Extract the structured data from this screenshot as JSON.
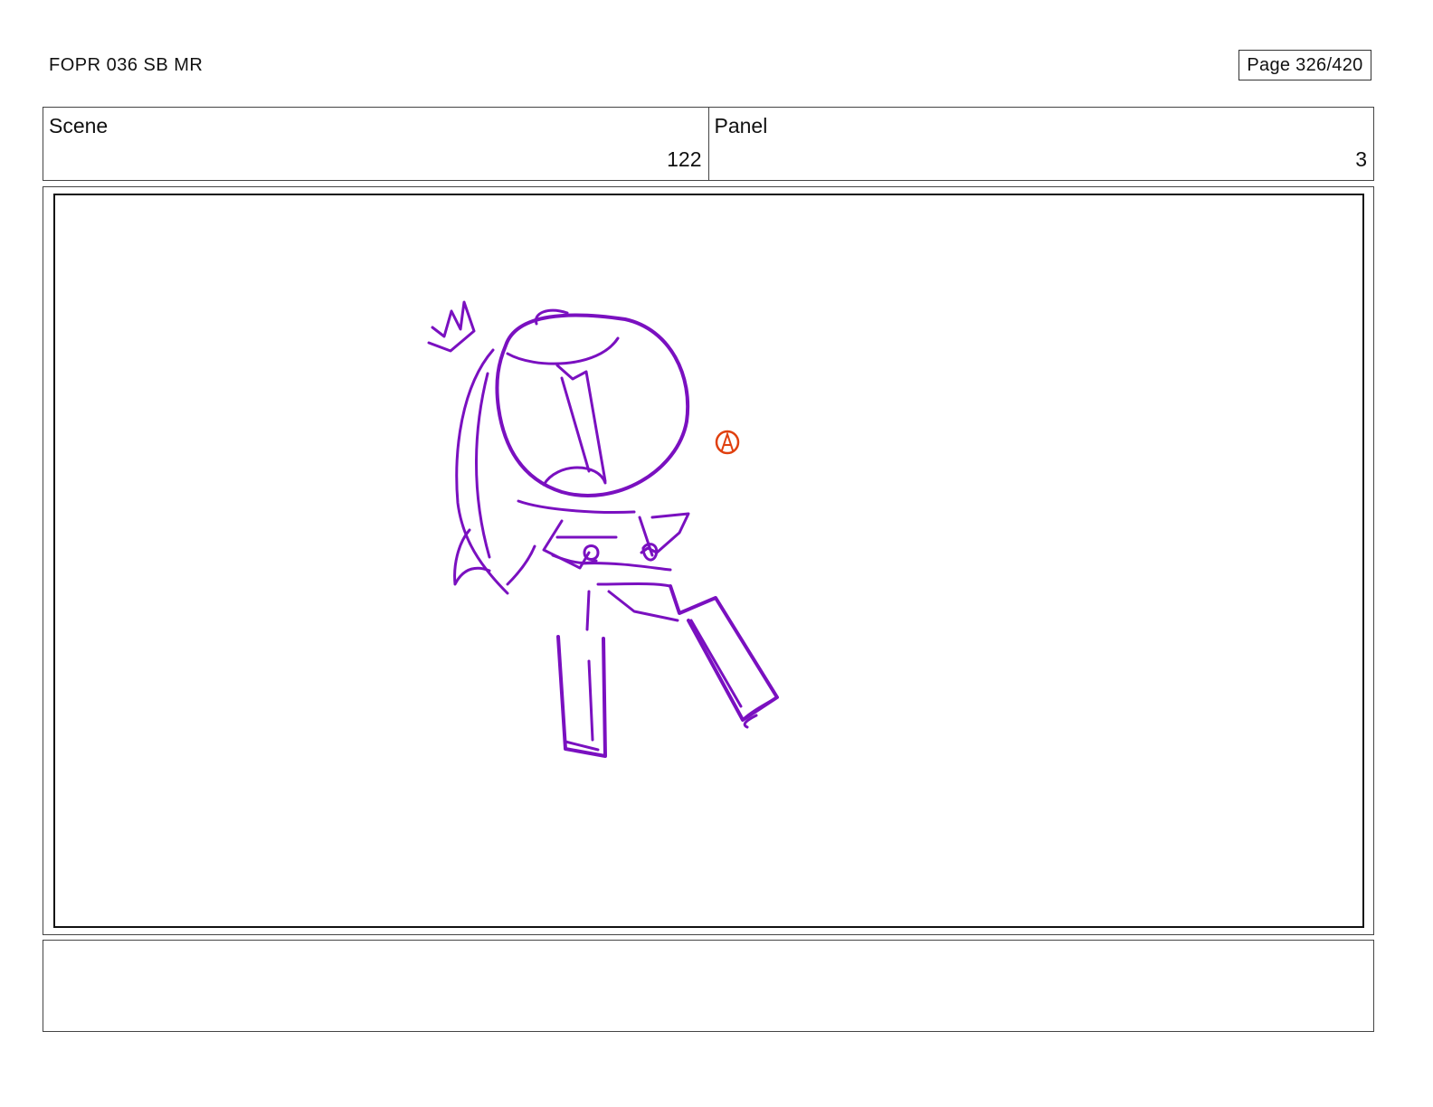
{
  "header": {
    "title": "FOPR 036 SB MR",
    "page_counter": "Page 326/420"
  },
  "info": {
    "scene_label": "Scene",
    "scene_value": "122",
    "panel_label": "Panel",
    "panel_value": "3"
  },
  "drawing": {
    "subject": "character-sketch",
    "stroke_color": "#7a10c0",
    "marker_color": "#e0400f",
    "marker_letter": "A"
  },
  "notes": {
    "text": ""
  }
}
